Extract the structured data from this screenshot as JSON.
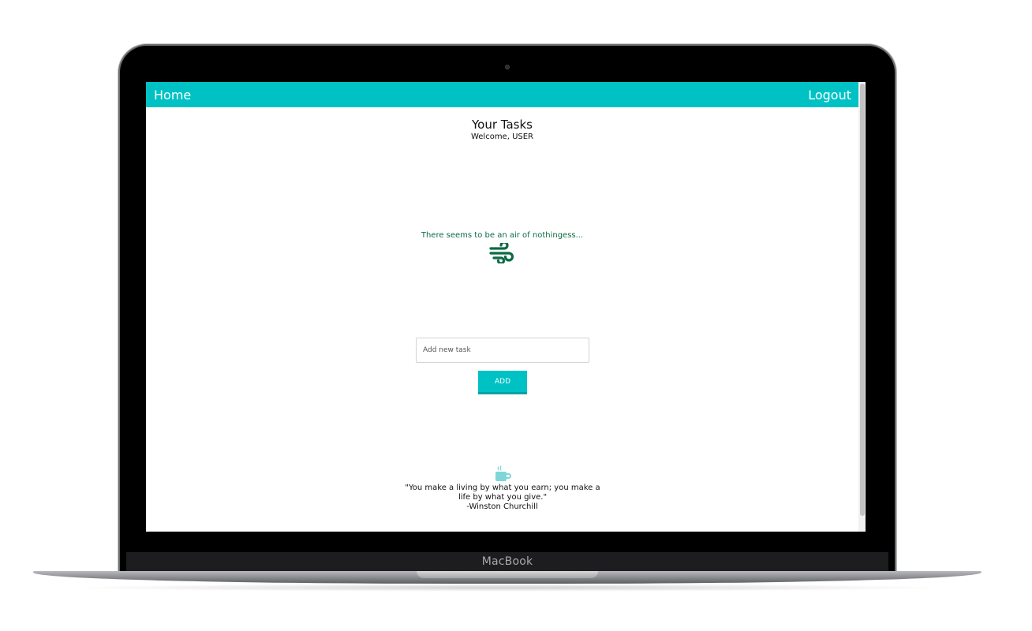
{
  "device": {
    "brand_label": "MacBook"
  },
  "navbar": {
    "home_label": "Home",
    "logout_label": "Logout",
    "color": "#00c2c4"
  },
  "header": {
    "title": "Your Tasks",
    "welcome": "Welcome, USER"
  },
  "empty_state": {
    "message": "There seems to be an air of nothingess...",
    "icon": "wind-icon",
    "color": "#0b6b43"
  },
  "task_form": {
    "input_placeholder": "Add new task",
    "input_value": "",
    "add_button_label": "ADD"
  },
  "quote": {
    "icon": "coffee-cup-icon",
    "text": "\"You make a living by what you earn; you make a life by what you give.\"",
    "author": "-Winston Churchill"
  }
}
